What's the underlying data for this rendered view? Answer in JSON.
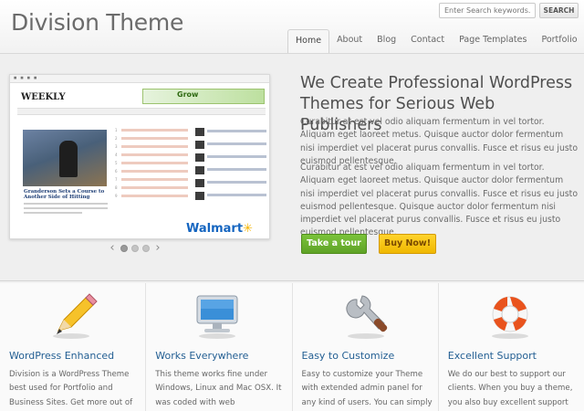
{
  "site": {
    "title": "Division Theme"
  },
  "search": {
    "placeholder": "Enter Search keywords...",
    "button": "SEARCH"
  },
  "nav": {
    "items": [
      "Home",
      "About",
      "Blog",
      "Contact",
      "Page Templates",
      "Portfolio"
    ],
    "active": "Home"
  },
  "slide": {
    "brand": "WEEKLY",
    "ad_text": "Grow",
    "headline": "Granderson Sets a Course to Another Side of Hitting",
    "sponsor": "Walmart"
  },
  "slider": {
    "prev": "‹",
    "next": "›",
    "count": 3,
    "active_index": 0
  },
  "hero": {
    "title": "We Create Professional WordPress Themes for Serious Web Publishers",
    "paragraphs": [
      "Curabitur at est vel odio aliquam fermentum in vel tortor. Aliquam eget laoreet metus. Quisque auctor dolor fermentum nisi imperdiet vel placerat purus convallis. Fusce et risus eu justo euismod pellentesque.",
      "Curabitur at est vel odio aliquam fermentum in vel tortor. Aliquam eget laoreet metus. Quisque auctor dolor fermentum nisi imperdiet vel placerat purus convallis. Fusce et risus eu justo euismod pellentesque. Quisque auctor dolor fermentum nisi imperdiet vel placerat purus convallis. Fusce et risus eu justo euismod pellentesque."
    ],
    "tour_button": "Take a tour",
    "buy_button": "Buy Now!"
  },
  "features": [
    {
      "icon": "pencil-icon",
      "title": "WordPress Enhanced",
      "desc": "Division is a WordPress Theme best used for Portfolio and Business Sites. Get more out of your Wordpress install with"
    },
    {
      "icon": "monitor-icon",
      "title": "Works Everywhere",
      "desc": "This theme works fine under Windows, Linux and Mac OSX. It was coded with web"
    },
    {
      "icon": "wrench-icon",
      "title": "Easy to Customize",
      "desc": "Easy to customize your Theme with extended admin panel for any kind of users. You can simply control your theme look"
    },
    {
      "icon": "lifebuoy-icon",
      "title": "Excellent Support",
      "desc": "We do our best to support our clients. When you buy a theme, you also buy excellent support from us. Our Customer Service"
    }
  ],
  "colors": {
    "link": "#235f93",
    "tour": "#6db22e",
    "buy": "#f5c20c"
  }
}
